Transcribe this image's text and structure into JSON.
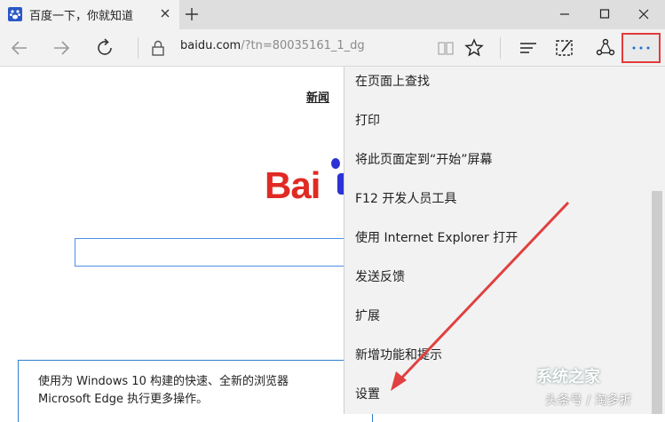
{
  "tab": {
    "title": "百度一下，你就知道"
  },
  "address_bar": {
    "domain": "baidu.com",
    "path": "/?tn=80035161_1_dg"
  },
  "page": {
    "news_link": "新闻",
    "logo_text": "Bai",
    "notice_line1": "使用为 Windows 10 构建的快速、全新的浏览器",
    "notice_line2": "Microsoft Edge 执行更多操作。"
  },
  "menu": {
    "items": [
      "在页面上查找",
      "打印",
      "将此页面定到“开始”屏幕",
      "F12 开发人员工具",
      "使用 Internet Explorer 打开",
      "发送反馈",
      "扩展",
      "新增功能和提示",
      "设置"
    ]
  },
  "watermark": {
    "main": "系统之家",
    "sub": "头条号 / 淘多折"
  },
  "colors": {
    "highlight_border": "#e43a3a",
    "arrow": "#e04040",
    "baidu_red": "#e02a24",
    "baidu_blue": "#2c32d5"
  }
}
